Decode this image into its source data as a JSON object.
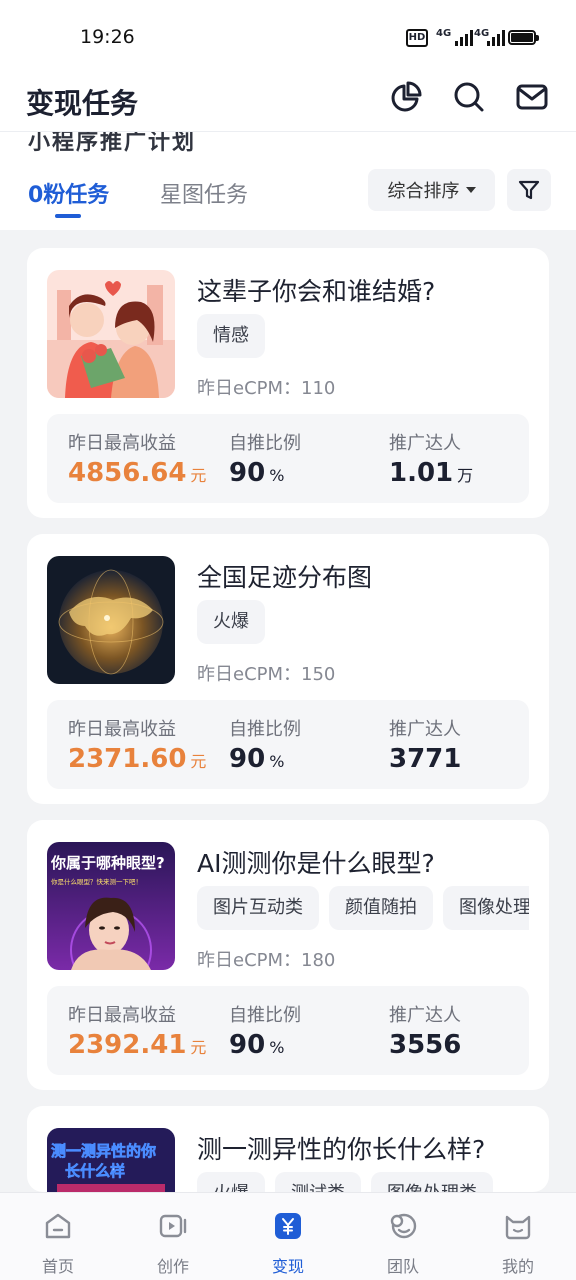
{
  "status": {
    "time": "19:26",
    "hd": "HD",
    "net1": "4G",
    "net2": "4G"
  },
  "header": {
    "title": "变现任务",
    "subtitle_partial": "小程序推广计划"
  },
  "tabs": [
    {
      "label": "0粉任务"
    },
    {
      "label": "星图任务"
    }
  ],
  "sort_label": "综合排序",
  "stat_labels": {
    "max_income": "昨日最高收益",
    "ratio": "自推比例",
    "promoters": "推广达人"
  },
  "cards": [
    {
      "title": "这辈子你会和谁结婚?",
      "tags": [
        "情感"
      ],
      "ecpm": "昨日eCPM：110",
      "income": "4856.64",
      "income_unit": "元",
      "ratio": "90",
      "ratio_unit": "%",
      "promoters": "1.01",
      "promoters_unit": "万"
    },
    {
      "title": "全国足迹分布图",
      "tags": [
        "火爆"
      ],
      "ecpm": "昨日eCPM：150",
      "income": "2371.60",
      "income_unit": "元",
      "ratio": "90",
      "ratio_unit": "%",
      "promoters": "3771",
      "promoters_unit": ""
    },
    {
      "title": "AI测测你是什么眼型?",
      "tags": [
        "图片互动类",
        "颜值随拍",
        "图像处理类"
      ],
      "ecpm": "昨日eCPM：180",
      "thumb_text_1": "你属于哪种眼型?",
      "thumb_text_2": "你是什么眼型？快来测一下吧！",
      "income": "2392.41",
      "income_unit": "元",
      "ratio": "90",
      "ratio_unit": "%",
      "promoters": "3556",
      "promoters_unit": ""
    },
    {
      "title": "测一测异性的你长什么样?",
      "tags": [
        "火爆",
        "测试类",
        "图像处理类"
      ],
      "thumb_text_1": "测一测异性的你",
      "thumb_text_2": "长什么样"
    }
  ],
  "nav": [
    {
      "label": "首页",
      "icon": "home-icon"
    },
    {
      "label": "创作",
      "icon": "video-create-icon"
    },
    {
      "label": "变现",
      "icon": "monetize-yen-icon"
    },
    {
      "label": "团队",
      "icon": "team-chat-icon"
    },
    {
      "label": "我的",
      "icon": "profile-cat-icon"
    }
  ],
  "colors": {
    "accent": "#1f5dd6",
    "income": "#e8823c",
    "background": "#f2f3f5"
  }
}
